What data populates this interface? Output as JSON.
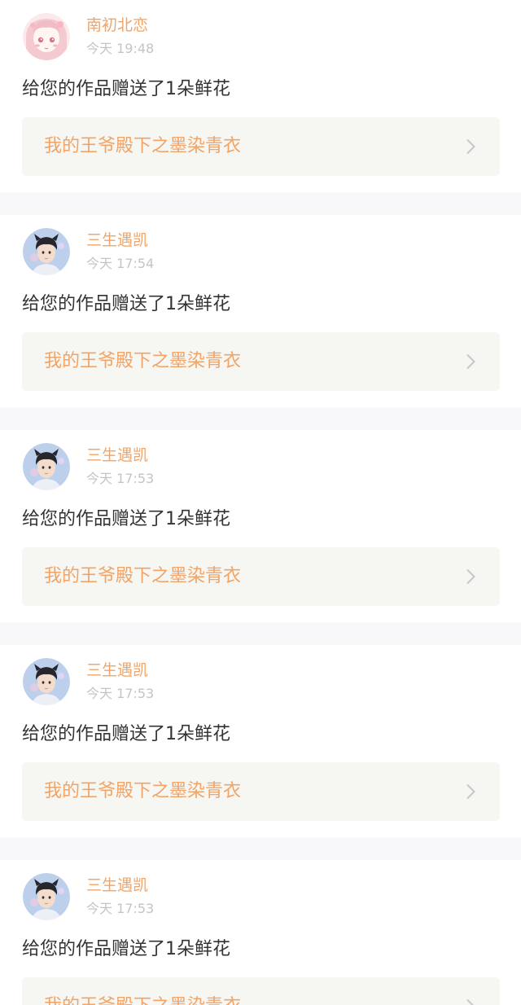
{
  "feed": {
    "items": [
      {
        "user": "南初北恋",
        "time": "今天 19:48",
        "message": "给您的作品赠送了1朵鲜花",
        "work": "我的王爷殿下之墨染青衣",
        "avatar_style": "pink-anime-girl"
      },
      {
        "user": "三生遇凯",
        "time": "今天 17:54",
        "message": "给您的作品赠送了1朵鲜花",
        "work": "我的王爷殿下之墨染青衣",
        "avatar_style": "boy-portrait"
      },
      {
        "user": "三生遇凯",
        "time": "今天 17:53",
        "message": "给您的作品赠送了1朵鲜花",
        "work": "我的王爷殿下之墨染青衣",
        "avatar_style": "boy-portrait"
      },
      {
        "user": "三生遇凯",
        "time": "今天 17:53",
        "message": "给您的作品赠送了1朵鲜花",
        "work": "我的王爷殿下之墨染青衣",
        "avatar_style": "boy-portrait"
      },
      {
        "user": "三生遇凯",
        "time": "今天 17:53",
        "message": "给您的作品赠送了1朵鲜花",
        "work": "我的王爷殿下之墨染青衣",
        "avatar_style": "boy-portrait"
      }
    ]
  },
  "icons": {
    "chevron": "chevron-right-icon",
    "avatar": "avatar"
  },
  "colors": {
    "accent": "#f0a468",
    "message_text": "#333333",
    "timestamp": "#c4c4c4",
    "link_background": "#f6f6f2",
    "separator": "#f8f8fa"
  }
}
